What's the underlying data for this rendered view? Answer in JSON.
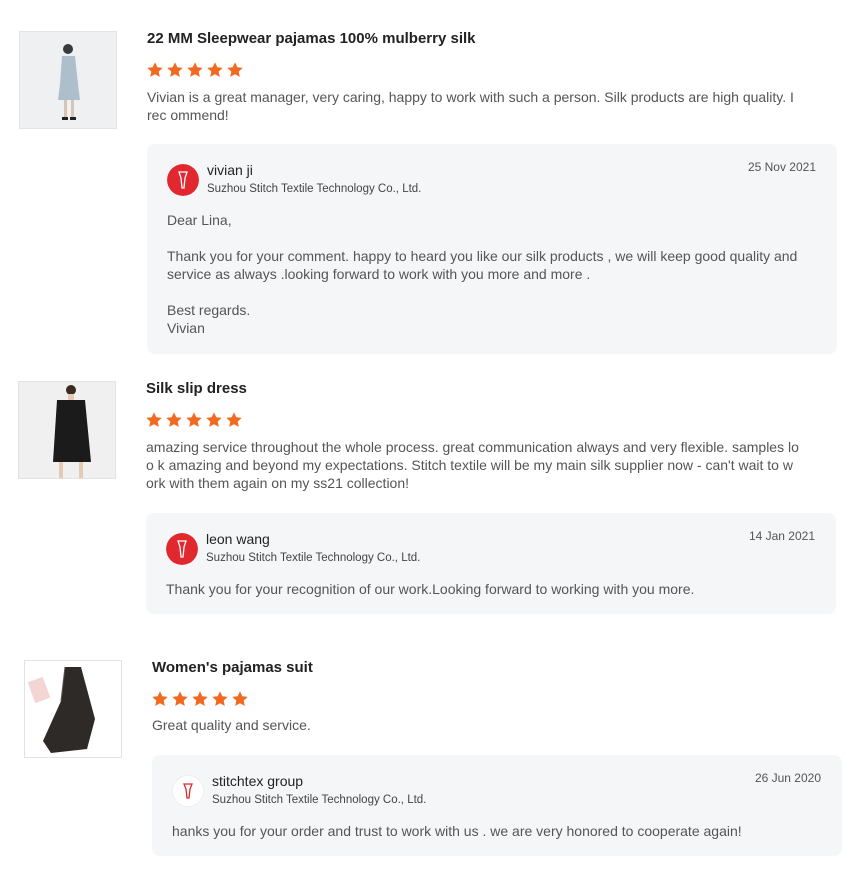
{
  "reviews": [
    {
      "title": "22 MM Sleepwear pajamas 100% mulberry silk",
      "rating": 5,
      "comment": "Vivian is a great manager, very caring, happy to work with such a person. Silk products are high quality. I rec ommend!",
      "image_icon": "product-photo",
      "reply": {
        "name": "vivian ji",
        "company": "Suzhou Stitch Textile Technology Co., Ltd.",
        "date": "25 Nov 2021",
        "text": "Dear Lina,\n\nThank you for your comment. happy to heard you like our silk products , we will keep good quality and service as always .looking forward to work with you more and more .\n\nBest regards.\nVivian"
      }
    },
    {
      "title": "Silk slip dress",
      "rating": 5,
      "comment": "amazing service throughout the whole process. great communication always and very flexible. samples loo k amazing and beyond my expectations. Stitch textile will be my main silk supplier now - can't wait to work with them again on my ss21 collection!",
      "image_icon": "product-photo",
      "reply": {
        "name": "leon wang",
        "company": "Suzhou Stitch Textile Technology Co., Ltd.",
        "date": "14 Jan 2021",
        "text": "Thank you for your recognition of our work.Looking forward to working with you more."
      }
    },
    {
      "title": "Women's pajamas suit",
      "rating": 5,
      "comment": "Great quality and service.",
      "image_icon": "product-photo",
      "reply": {
        "name": "stitchtex group",
        "company": "Suzhou Stitch Textile Technology Co., Ltd.",
        "date": "26 Jun 2020",
        "text": "hanks you for your order and trust to work with us . we are very honored to cooperate again!"
      }
    }
  ],
  "colors": {
    "star": "#f26a21",
    "avatar_red": "#e2282f",
    "reply_bg": "#f5f6f8"
  }
}
